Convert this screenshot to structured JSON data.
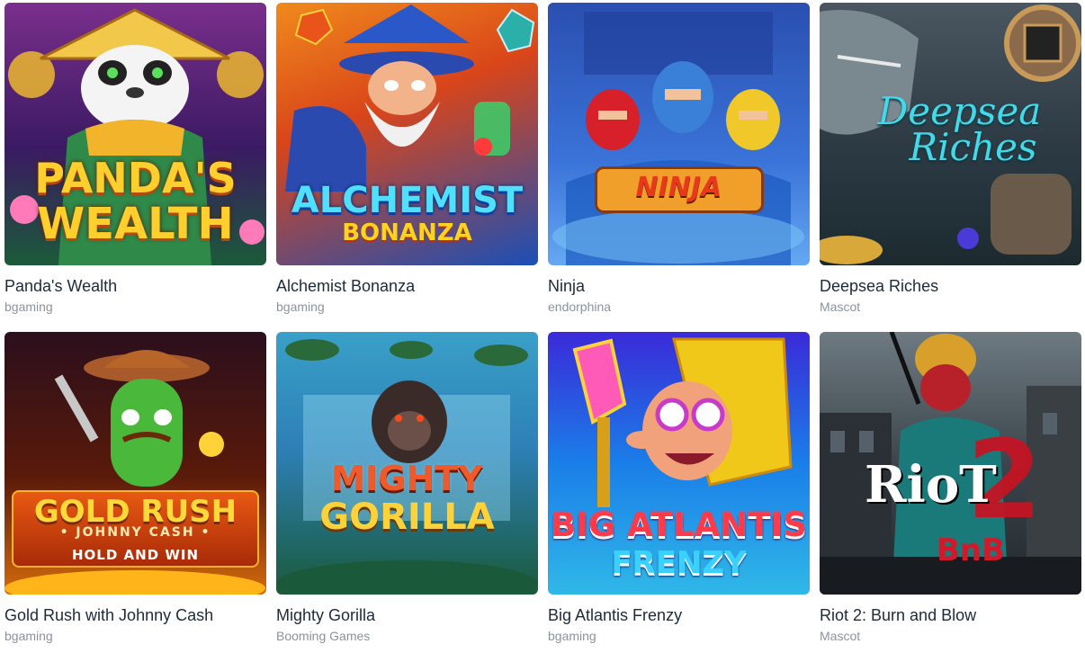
{
  "games": [
    {
      "name": "Panda's Wealth",
      "provider": "bgaming",
      "logo": [
        "PANDA'S",
        "WEALTH"
      ]
    },
    {
      "name": "Alchemist Bonanza",
      "provider": "bgaming",
      "logo": [
        "ALCHEMIST",
        "BONANZA"
      ]
    },
    {
      "name": "Ninja",
      "provider": "endorphina",
      "logo": [
        "NINJA"
      ]
    },
    {
      "name": "Deepsea Riches",
      "provider": "Mascot",
      "logo": [
        "Deepsea",
        "Riches"
      ]
    },
    {
      "name": "Gold Rush with Johnny Cash",
      "provider": "bgaming",
      "logo": [
        "GOLD RUSH",
        "• JOHNNY CASH •",
        "HOLD AND WIN"
      ]
    },
    {
      "name": "Mighty Gorilla",
      "provider": "Booming Games",
      "logo": [
        "MIGHTY",
        "GORILLA"
      ]
    },
    {
      "name": "Big Atlantis Frenzy",
      "provider": "bgaming",
      "logo": [
        "BIG ATLANTIS",
        "FRENZY"
      ]
    },
    {
      "name": "Riot 2: Burn and Blow",
      "provider": "Mascot",
      "logo": [
        "RioT",
        "BnB",
        "2"
      ]
    }
  ]
}
